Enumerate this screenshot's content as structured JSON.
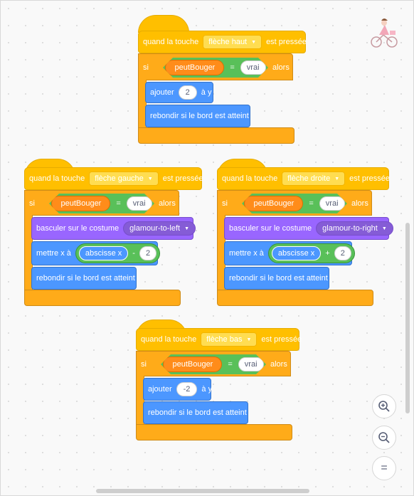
{
  "scripts": {
    "up": {
      "hat_prefix": "quand la touche",
      "key": "flèche haut",
      "hat_suffix": "est pressée",
      "if_label": "si",
      "var": "peutBouger",
      "eq": "=",
      "val": "vrai",
      "then_label": "alors",
      "change_prefix": "ajouter",
      "change_val": "2",
      "change_suffix": "à y",
      "bounce": "rebondir si le bord est atteint"
    },
    "left": {
      "hat_prefix": "quand la touche",
      "key": "flèche gauche",
      "hat_suffix": "est pressée",
      "if_label": "si",
      "var": "peutBouger",
      "eq": "=",
      "val": "vrai",
      "then_label": "alors",
      "costume_prefix": "basculer sur le costume",
      "costume": "glamour-to-left",
      "setx_prefix": "mettre x à",
      "abs": "abscisse x",
      "op": "-",
      "num": "2",
      "bounce": "rebondir si le bord est atteint"
    },
    "right": {
      "hat_prefix": "quand la touche",
      "key": "flèche droite",
      "hat_suffix": "est pressée",
      "if_label": "si",
      "var": "peutBouger",
      "eq": "=",
      "val": "vrai",
      "then_label": "alors",
      "costume_prefix": "basculer sur le costume",
      "costume": "glamour-to-right",
      "setx_prefix": "mettre x à",
      "abs": "abscisse x",
      "op": "+",
      "num": "2",
      "bounce": "rebondir si le bord est atteint"
    },
    "down": {
      "hat_prefix": "quand la touche",
      "key": "flèche bas",
      "hat_suffix": "est pressée",
      "if_label": "si",
      "var": "peutBouger",
      "eq": "=",
      "val": "vrai",
      "then_label": "alors",
      "change_prefix": "ajouter",
      "change_val": "-2",
      "change_suffix": "à y",
      "bounce": "rebondir si le bord est atteint"
    }
  },
  "zoom": {
    "zoom_in": "+",
    "zoom_out": "−",
    "reset": "="
  },
  "icons": {
    "dropdown": "▼"
  }
}
